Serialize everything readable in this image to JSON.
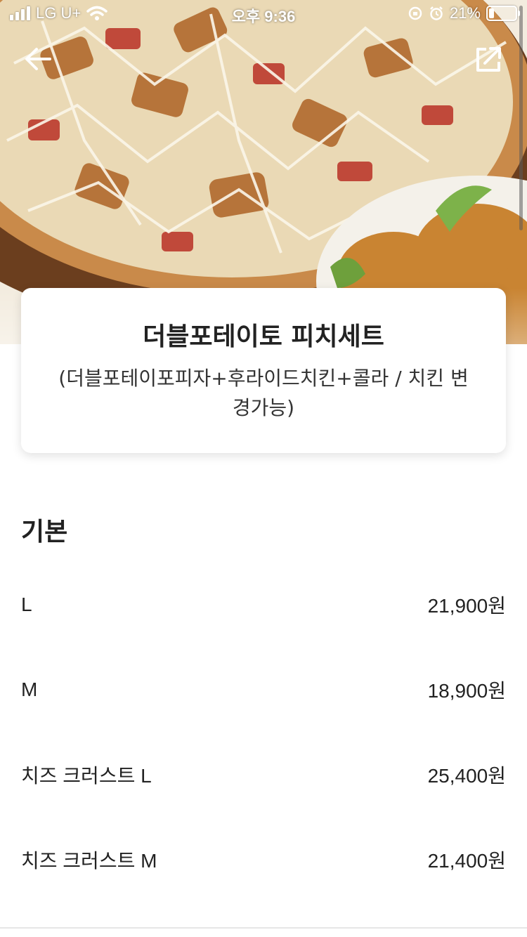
{
  "status_bar": {
    "carrier": "LG U+",
    "time": "오후 9:36",
    "battery_percent_label": "21%",
    "battery_level": 0.21,
    "icons": [
      "signal-icon",
      "wifi-icon",
      "orientation-lock-icon",
      "alarm-icon",
      "battery-icon"
    ]
  },
  "header": {
    "back_icon": "arrow-left-icon",
    "share_icon": "share-icon"
  },
  "product": {
    "title": "더블포테이토 피치세트",
    "description": "(더블포테이포피자+후라이드치킨+콜라 / 치킨 변경가능)"
  },
  "options": {
    "section_title": "기본",
    "items": [
      {
        "name": "L",
        "price": "21,900원"
      },
      {
        "name": "M",
        "price": "18,900원"
      },
      {
        "name": "치즈 크러스트 L",
        "price": "25,400원"
      },
      {
        "name": "치즈 크러스트 M",
        "price": "21,400원"
      }
    ]
  },
  "colors": {
    "text_primary": "#222222",
    "card_background": "#ffffff",
    "status_text": "#ffffff"
  }
}
